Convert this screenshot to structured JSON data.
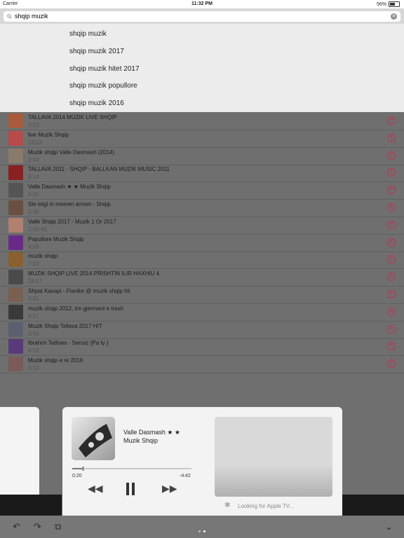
{
  "status": {
    "carrier": "Carrier",
    "time": "11:32 PM",
    "battery": "56%"
  },
  "search": {
    "value": "shqip muzik"
  },
  "suggestions": [
    "shqip muzik",
    "shqip muzik 2017",
    "shqip muzik hitet 2017",
    "shqip muzik popullore",
    "shqip muzik 2016"
  ],
  "songs": [
    {
      "title": "TALLAVA 2014 MUZIK LIVE SHQIP",
      "duration": "3:53",
      "color": "#a85a3a"
    },
    {
      "title": "live  Muzik Shqip",
      "duration": "18:13",
      "color": "#b84a4a"
    },
    {
      "title": "Muzik shqip Valle Dasmash (2014)",
      "duration": "3:43",
      "color": "#8a7a6a"
    },
    {
      "title": "TALLAVA 2011 - SHQIP - BALLKAN MUZIK MUSIC 2011",
      "duration": "9:14",
      "color": "#8a2020"
    },
    {
      "title": "Valle Dasmash ★ ★ Muzik Shqip",
      "duration": "5:02",
      "color": "#555555"
    },
    {
      "title": "Sie leigt in meinen armen - Shqip",
      "duration": "3:36",
      "color": "#6a5040"
    },
    {
      "title": "Valle Shqip 2017 - Muzik 1 Or 2017",
      "duration": "1:00:46",
      "color": "#b08070"
    },
    {
      "title": "Popullore Muzik Shqip",
      "duration": "4:09",
      "color": "#6a2a8a"
    },
    {
      "title": "muzik shqip",
      "duration": "7:13",
      "color": "#8a6030"
    },
    {
      "title": "MUZIK SHQIP  LIVE  2014 PRISHTIN  ILIR HAXHIU 4",
      "duration": "24:57",
      "color": "#4a4a4a"
    },
    {
      "title": "Shpat Kasapi - Fisnike @ muzik shqip hit",
      "duration": "3:55",
      "color": "#7a6050"
    },
    {
      "title": "muzik shqip 2012, tre gjermant e trash",
      "duration": "4:27",
      "color": "#3a3a3a"
    },
    {
      "title": "Muzik Shqip Tallava 2017 HIT",
      "duration": "3:56",
      "color": "#5a6070"
    },
    {
      "title": "Ibrahim Tatlises - Sensiz {Pa ty }",
      "duration": "4:03",
      "color": "#5a3a7a"
    },
    {
      "title": "Muzik shqip e re 2016",
      "duration": "3:14",
      "color": "#7a5a5a"
    }
  ],
  "player": {
    "title": "Valle Dasmash ★ ★",
    "artist": "Muzik Shqip",
    "elapsed": "0:20",
    "remaining": "-4:42",
    "progress": 0.08,
    "airplay_status": "Looking for Apple TV..."
  },
  "icons": {
    "search": "search-icon",
    "clear": "clear-icon",
    "add": "add-icon",
    "rewind": "rewind-icon",
    "pause": "pause-icon",
    "forward": "forward-icon"
  }
}
